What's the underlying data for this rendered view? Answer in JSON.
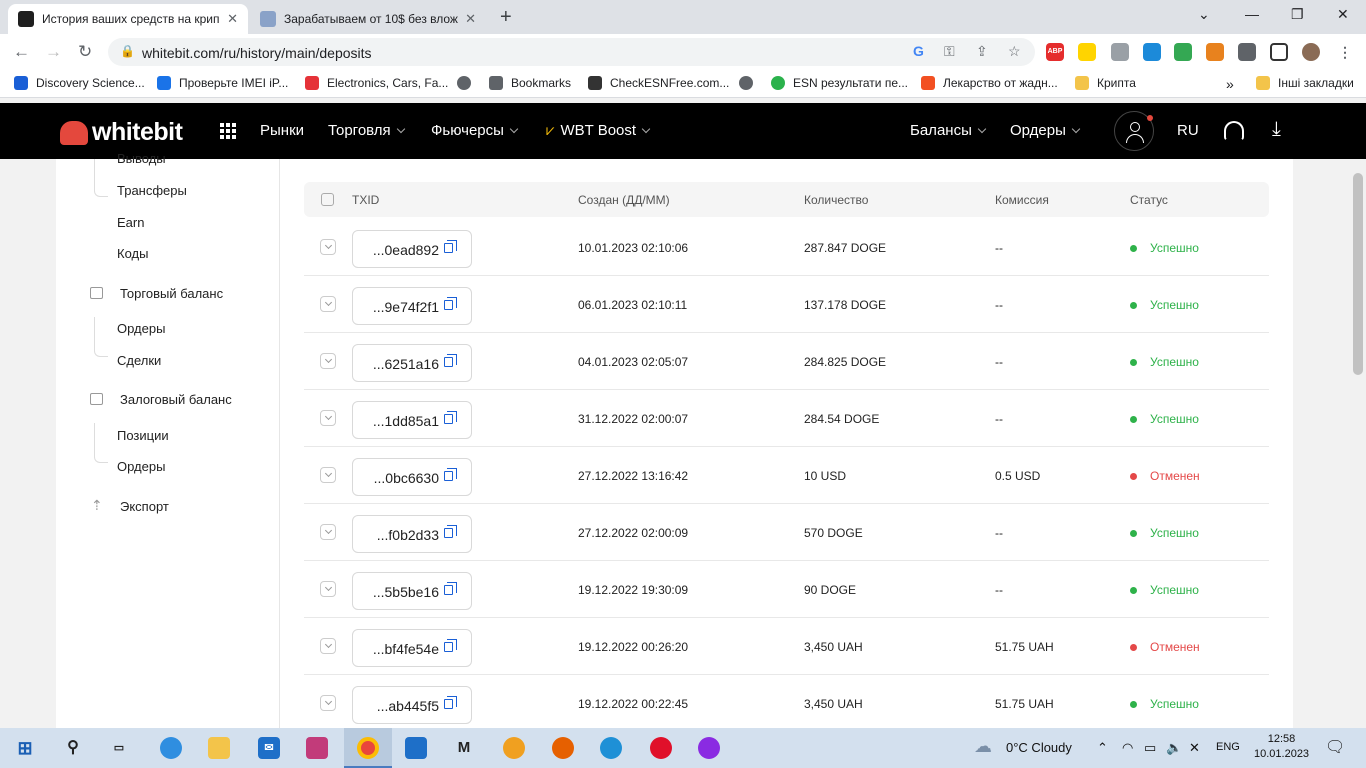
{
  "browser": {
    "tabs": [
      {
        "title": "История ваших средств на крип"
      },
      {
        "title": "Зарабатываем от 10$ без влож"
      }
    ],
    "url": "whitebit.com/ru/history/main/deposits",
    "bookmarks": [
      {
        "label": "Discovery Science..."
      },
      {
        "label": "Проверьте IMEI iP..."
      },
      {
        "label": "Electronics, Cars, Fa..."
      },
      {
        "label": "Bookmarks"
      },
      {
        "label": "CheckESNFree.com..."
      },
      {
        "label": "ESN результати пе..."
      },
      {
        "label": "Лекарство от жадн..."
      },
      {
        "label": "Крипта"
      }
    ],
    "other_bookmarks": "Інші закладки",
    "extensions": {
      "abp": "ABP"
    }
  },
  "header": {
    "logo": "whitebit",
    "nav": [
      "Рынки",
      "Торговля",
      "Фьючерсы",
      "WBT Boost"
    ],
    "right_nav": [
      "Балансы",
      "Ордеры"
    ],
    "lang": "RU"
  },
  "sidebar": {
    "items": [
      {
        "label": "Выводы"
      },
      {
        "label": "Трансферы"
      },
      {
        "label": "Earn"
      },
      {
        "label": "Коды"
      },
      {
        "label": "Торговый баланс"
      },
      {
        "label": "Ордеры"
      },
      {
        "label": "Сделки"
      },
      {
        "label": "Залоговый баланс"
      },
      {
        "label": "Позиции"
      },
      {
        "label": "Ордеры"
      },
      {
        "label": "Экспорт"
      }
    ]
  },
  "table": {
    "headers": [
      "TXID",
      "Создан (ДД/ММ)",
      "Количество",
      "Комиссия",
      "Статус"
    ],
    "rows": [
      {
        "txid": "...0ead892",
        "created": "10.01.2023 02:10:06",
        "amount": "287.847 DOGE",
        "fee": "--",
        "status": "Успешно"
      },
      {
        "txid": "...9e74f2f1",
        "created": "06.01.2023 02:10:11",
        "amount": "137.178 DOGE",
        "fee": "--",
        "status": "Успешно"
      },
      {
        "txid": "...6251a16",
        "created": "04.01.2023 02:05:07",
        "amount": "284.825 DOGE",
        "fee": "--",
        "status": "Успешно"
      },
      {
        "txid": "...1dd85a1",
        "created": "31.12.2022 02:00:07",
        "amount": "284.54 DOGE",
        "fee": "--",
        "status": "Успешно"
      },
      {
        "txid": "...0bc6630",
        "created": "27.12.2022 13:16:42",
        "amount": "10 USD",
        "fee": "0.5 USD",
        "status": "Отменен"
      },
      {
        "txid": "...f0b2d33",
        "created": "27.12.2022 02:00:09",
        "amount": "570 DOGE",
        "fee": "--",
        "status": "Успешно"
      },
      {
        "txid": "...5b5be16",
        "created": "19.12.2022 19:30:09",
        "amount": "90 DOGE",
        "fee": "--",
        "status": "Успешно"
      },
      {
        "txid": "...bf4fe54e",
        "created": "19.12.2022 00:26:20",
        "amount": "3,450 UAH",
        "fee": "51.75 UAH",
        "status": "Отменен"
      },
      {
        "txid": "...ab445f5",
        "created": "19.12.2022 00:22:45",
        "amount": "3,450 UAH",
        "fee": "51.75 UAH",
        "status": "Успешно"
      }
    ]
  },
  "colors": {
    "success": "#2eb24a",
    "cancelled": "#e44848",
    "brand": "#e4483d"
  },
  "taskbar": {
    "weather": "0°C  Cloudy",
    "lang": "ENG",
    "time": "12:58",
    "date": "10.01.2023",
    "app_m": "M"
  }
}
